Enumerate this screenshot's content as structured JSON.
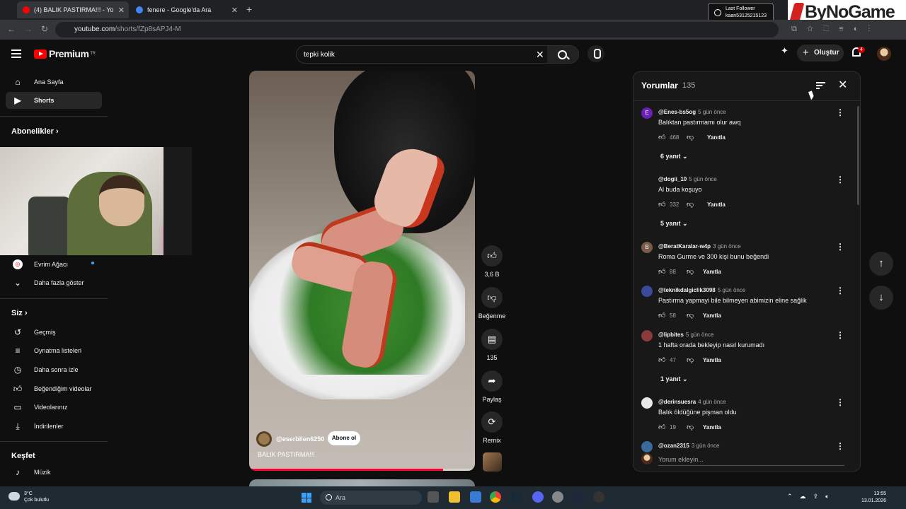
{
  "browser": {
    "tabs": [
      {
        "title": "(4) BALIK PASTIRMA!!! - Yo",
        "active": true
      },
      {
        "title": "fenere - Google'da Ara",
        "active": false
      }
    ],
    "url_host": "youtube.com",
    "url_path": "/shorts/fZp8sAPJ4-M"
  },
  "overlay": {
    "last_follower_label": "Last Follower",
    "last_follower_name": "kaan53125215123",
    "brand": "ByNoGame"
  },
  "header": {
    "logo_text": "Premium",
    "country": "TR",
    "search_value": "tepki kolik",
    "create_label": "Oluştur",
    "notif_count": "4"
  },
  "sidebar": {
    "main": [
      {
        "label": "Ana Sayfa",
        "icon": "home-icon"
      },
      {
        "label": "Shorts",
        "icon": "shorts-icon"
      }
    ],
    "subscriptions_heading": "Abonelikler",
    "subscriptions": [
      {
        "label": "Evrim Ağacı"
      }
    ],
    "show_more": "Daha fazla göster",
    "you_heading": "Siz",
    "you_items": [
      {
        "label": "Geçmiş",
        "icon": "history-icon"
      },
      {
        "label": "Oynatma listeleri",
        "icon": "playlist-icon"
      },
      {
        "label": "Daha sonra izle",
        "icon": "watch-later-icon"
      },
      {
        "label": "Beğendiğim videolar",
        "icon": "liked-icon"
      },
      {
        "label": "Videolarınız",
        "icon": "your-videos-icon"
      },
      {
        "label": "İndirilenler",
        "icon": "download-icon"
      }
    ],
    "explore_heading": "Keşfet",
    "explore_items": [
      {
        "label": "Müzik",
        "icon": "music-icon"
      }
    ]
  },
  "short": {
    "channel": "@eserbilen6250",
    "subscribe_label": "Abone ol",
    "title": "BALIK PASTIRMA!!!",
    "progress": 0.86,
    "actions": {
      "likes": "3,6 B",
      "dislike_label": "Beğenme",
      "comments": "135",
      "share_label": "Paylaş",
      "remix_label": "Remix"
    }
  },
  "comments": {
    "title": "Yorumlar",
    "count": "135",
    "reply_label": "Yanıtla",
    "input_placeholder": "Yorum ekleyin...",
    "items": [
      {
        "avatar": "E",
        "avatar_color": "#6a1fb5",
        "user": "@Enes-bs5og",
        "time": "5 gün önce",
        "text": "Balıktan pastırmamı olur awq",
        "likes": "468",
        "replies": "6 yanıt"
      },
      {
        "avatar": "",
        "avatar_color": "#181818",
        "user": "@dogii_10",
        "time": "5 gün önce",
        "text": "Al buda koşuyo",
        "likes": "332",
        "replies": "5 yanıt"
      },
      {
        "avatar": "B",
        "avatar_color": "#7a5a4a",
        "user": "@BeratKaralar-w4p",
        "time": "3 gün önce",
        "text": "Roma Gurme ve 300 kişi bunu beğendi",
        "likes": "88",
        "replies": ""
      },
      {
        "avatar": "",
        "avatar_color": "#3a4a9a",
        "user": "@teknikdalgiclik3098",
        "time": "5 gün önce",
        "text": "Pastırma yapmayi bile bilmeyen abimizin  eline sağlik",
        "likes": "58",
        "replies": ""
      },
      {
        "avatar": "",
        "avatar_color": "#8a3a3a",
        "user": "@lipbites",
        "time": "5 gün önce",
        "text": "1 hafta orada bekleyip nasıl kurumadı",
        "likes": "47",
        "replies": "1 yanıt"
      },
      {
        "avatar": "",
        "avatar_color": "#e8e8e8",
        "user": "@derinsuesra",
        "time": "4 gün önce",
        "text": "Balık öldüğüne pişman oldu",
        "likes": "19",
        "replies": ""
      },
      {
        "avatar": "",
        "avatar_color": "#3a6a9a",
        "user": "@ozan2315",
        "time": "3 gün önce",
        "text": "",
        "likes": "",
        "replies": ""
      }
    ]
  },
  "taskbar": {
    "temperature": "3°C",
    "weather": "Çok bulutlu",
    "search_placeholder": "Ara",
    "time": "13:55",
    "date": "13.01.2026"
  }
}
